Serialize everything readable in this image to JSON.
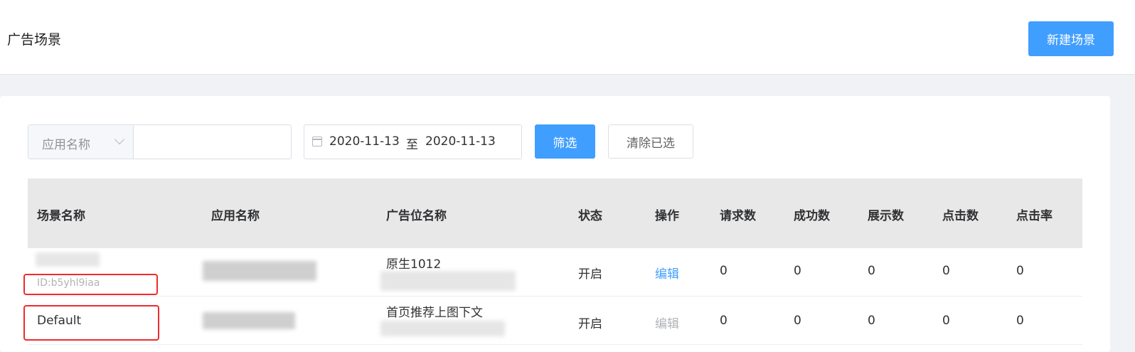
{
  "header": {
    "title": "广告场景",
    "new_button": "新建场景"
  },
  "filters": {
    "app_select_label": "应用名称",
    "app_input_value": "",
    "date_start": "2020-11-13",
    "date_separator": "至",
    "date_end": "2020-11-13",
    "filter_button": "筛选",
    "clear_button": "清除已选"
  },
  "table": {
    "headers": [
      "场景名称",
      "应用名称",
      "广告位名称",
      "状态",
      "操作",
      "请求数",
      "成功数",
      "展示数",
      "点击数",
      "点击率"
    ],
    "rows": [
      {
        "scene_name": "",
        "scene_id": "ID:b5yhl9iaa",
        "app_name": "",
        "ad_slot_name": "原生1012",
        "status": "开启",
        "action": "编辑",
        "requests": "0",
        "success": "0",
        "impressions": "0",
        "clicks": "0",
        "ctr": "0"
      },
      {
        "scene_name": "Default",
        "scene_id": "",
        "app_name": "",
        "ad_slot_name": "首页推荐上图下文",
        "status": "开启",
        "action": "编辑",
        "requests": "0",
        "success": "0",
        "impressions": "0",
        "clicks": "0",
        "ctr": "0"
      }
    ]
  },
  "colors": {
    "primary": "#409eff",
    "highlight": "#ef2b2b",
    "header_bg": "#e8e8e8"
  }
}
